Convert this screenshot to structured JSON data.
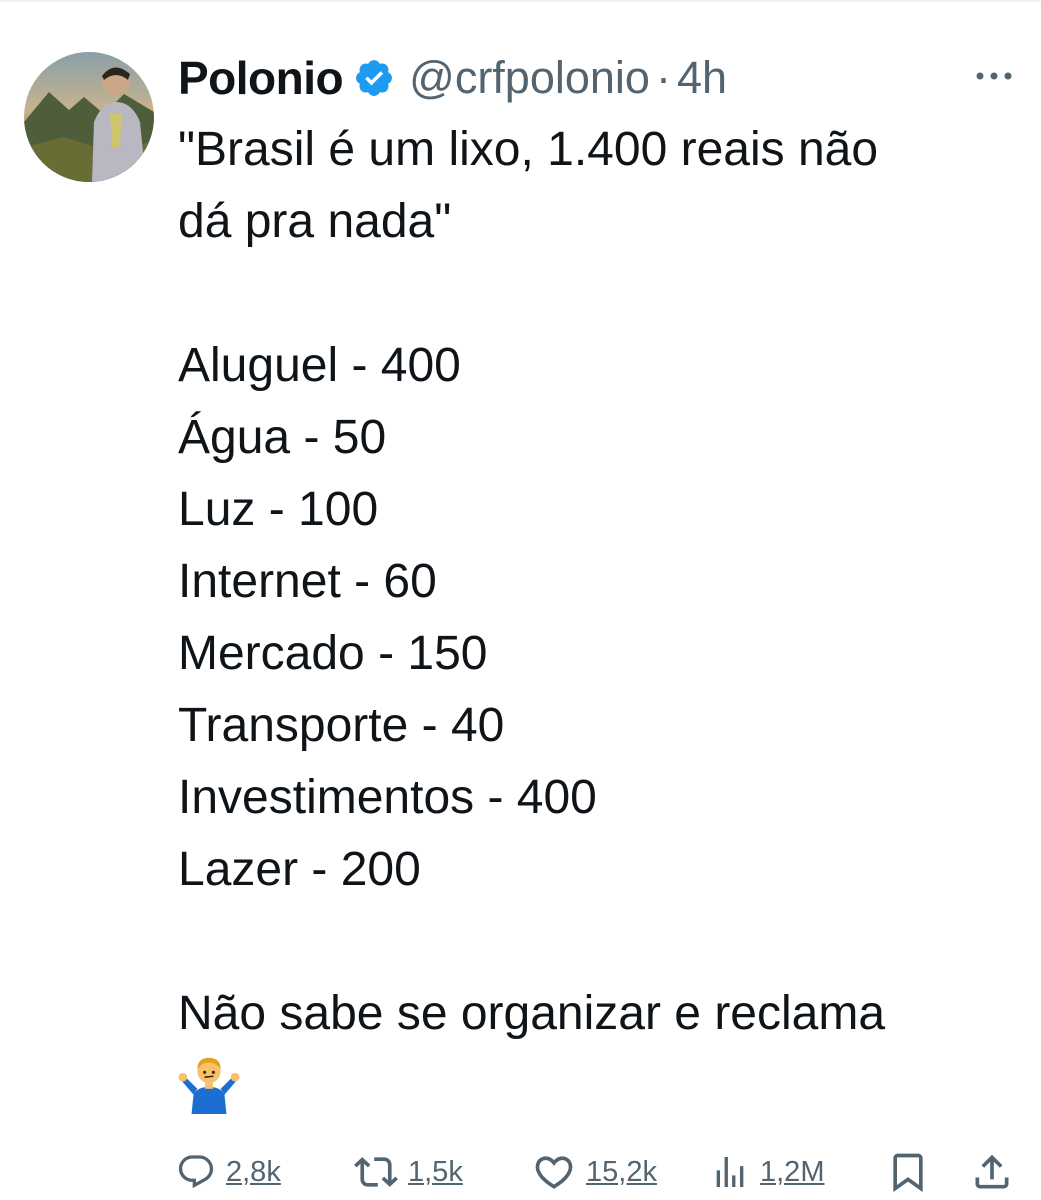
{
  "tweet": {
    "author": {
      "display_name": "Polonio",
      "handle": "@crfpolonio",
      "verified": true
    },
    "separator": "·",
    "time": "4h",
    "text_lines": [
      "\"Brasil é um lixo, 1.400 reais não",
      "dá pra nada\"",
      "Aluguel - 400",
      "Água - 50",
      "Luz - 100",
      "Internet - 60",
      "Mercado - 150",
      "Transporte - 40",
      "Investimentos - 400",
      "Lazer - 200",
      "Não sabe se organizar e reclama"
    ],
    "emoji": "man-shrugging-icon"
  },
  "actions": {
    "reply_count": "2,8k",
    "retweet_count": "1,5k",
    "like_count": "15,2k",
    "views_count": "1,2M"
  },
  "colors": {
    "verified_blue": "#1d9bf0",
    "text_primary": "#0f1419",
    "text_secondary": "#536471"
  }
}
